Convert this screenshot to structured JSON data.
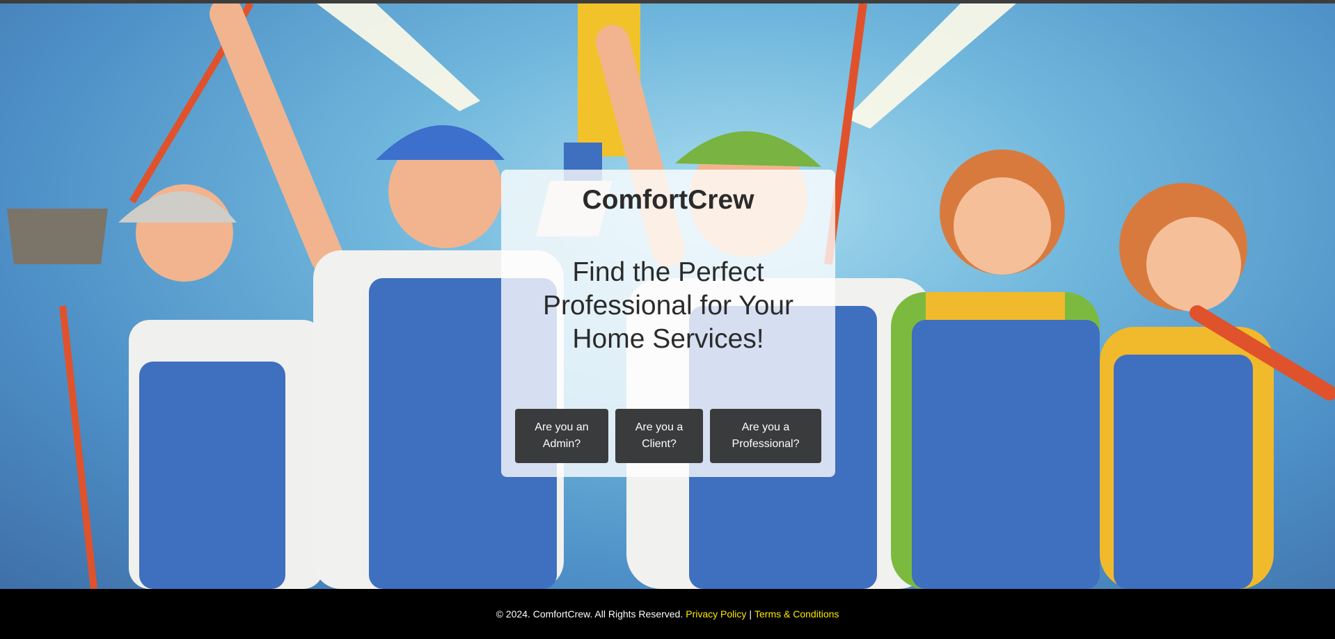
{
  "brand": {
    "name": "ComfortCrew"
  },
  "hero": {
    "headline": "Find the Perfect Professional for Your Home Services!",
    "background_image": "illustration of five smiling home service workers in blue overalls holding brooms and brushes"
  },
  "role_buttons": [
    {
      "label": "Are you an Admin?"
    },
    {
      "label": "Are you a Client?"
    },
    {
      "label": "Are you a Professional?"
    }
  ],
  "footer": {
    "copyright": "© 2024. ComfortCrew. All Rights Reserved.",
    "privacy_label": "Privacy Policy",
    "separator": "|",
    "terms_label": "Terms & Conditions",
    "link_color": "#ffeb00"
  },
  "colors": {
    "button_bg": "#3a3b3c",
    "footer_bg": "#000000",
    "sky": "#6fb6dc"
  }
}
